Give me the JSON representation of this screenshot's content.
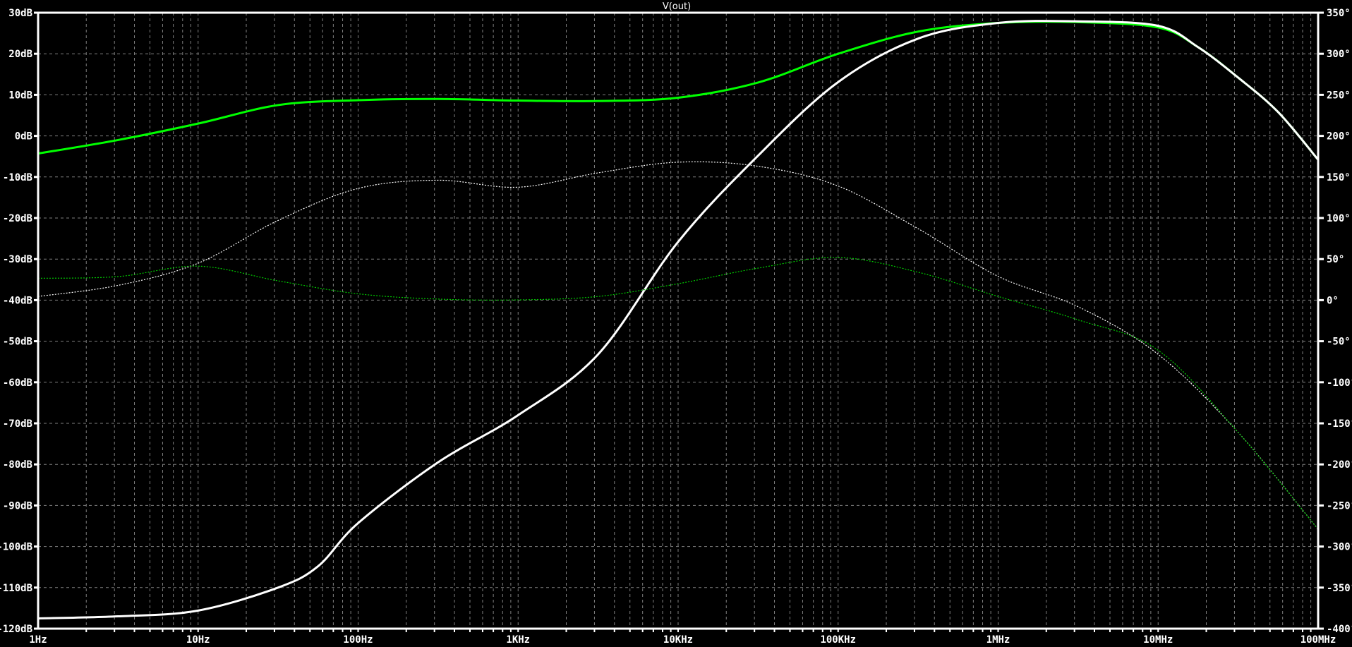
{
  "chart_data": {
    "type": "line",
    "title": "V(out)",
    "x_scale": "log",
    "xlim": [
      1,
      100000000
    ],
    "x_ticks": [
      1,
      10,
      100,
      1000,
      10000,
      100000,
      1000000,
      10000000,
      100000000
    ],
    "x_tick_labels": [
      "1Hz",
      "10Hz",
      "100Hz",
      "1KHz",
      "10KHz",
      "100KHz",
      "1MHz",
      "10MHz",
      "100MHz"
    ],
    "ylim_left": [
      -120,
      30
    ],
    "y_left_ticks": [
      30,
      20,
      10,
      0,
      -10,
      -20,
      -30,
      -40,
      -50,
      -60,
      -70,
      -80,
      -90,
      -100,
      -110,
      -120
    ],
    "y_left_tick_labels": [
      "30dB",
      "20dB",
      "10dB",
      "0dB",
      "-10dB",
      "-20dB",
      "-30dB",
      "-40dB",
      "-50dB",
      "-60dB",
      "-70dB",
      "-80dB",
      "-90dB",
      "-100dB",
      "-110dB",
      "-120dB"
    ],
    "ylim_right": [
      -400,
      350
    ],
    "y_right_tick_labels": [
      "350°",
      "300°",
      "250°",
      "200°",
      "150°",
      "100°",
      "50°",
      "0°",
      "-50°",
      "-100°",
      "-150°",
      "-200°",
      "-250°",
      "-300°",
      "-350°",
      "-400°"
    ],
    "grid": true,
    "background": "#000000",
    "grid_color": "#808080",
    "x": [
      1,
      3.16,
      10,
      31.6,
      100,
      316,
      1000,
      3162,
      10000,
      31623,
      100000,
      316228,
      1000000,
      3162278,
      10000000,
      17783,
      31622777,
      56234133,
      100000000
    ],
    "series": [
      {
        "axis": "left",
        "color": "#00ff00",
        "style": "solid",
        "x": [
          1,
          3.16,
          10,
          31.6,
          100,
          316,
          1000,
          3162,
          10000,
          31623,
          100000,
          316228,
          1000000,
          3162278,
          10000000,
          17782794,
          31622777,
          56234133,
          100000000
        ],
        "values": [
          -4.3,
          -1,
          3,
          7.5,
          8.7,
          9,
          8.6,
          8.5,
          9.3,
          13,
          20,
          25.4,
          27.5,
          27.7,
          26.4,
          21.6,
          14.2,
          5.8,
          -5.8
        ]
      },
      {
        "axis": "left",
        "color": "#ffffff",
        "style": "solid",
        "x": [
          1,
          3.16,
          10,
          31.6,
          56.2,
          100,
          316,
          1000,
          3162,
          10000,
          31623,
          100000,
          316228,
          1000000,
          3162278,
          10000000,
          17782794,
          31622777,
          56234133,
          100000000
        ],
        "values": [
          -117.5,
          -117,
          -115.6,
          -110,
          -104.8,
          -94.3,
          -79.5,
          -68,
          -53.2,
          -25.8,
          -4.8,
          13.1,
          23.7,
          27.5,
          27.9,
          26.8,
          21.6,
          14.2,
          5.8,
          -5.8
        ]
      },
      {
        "axis": "right",
        "color": "#ffffff",
        "style": "dotted",
        "x": [
          1,
          3.16,
          10,
          31.6,
          100,
          316,
          1000,
          3162,
          10000,
          31623,
          100000,
          316228,
          1000000,
          3162278,
          10000000,
          31622777,
          100000000
        ],
        "values": [
          4.5,
          18,
          45,
          97,
          136,
          146,
          137.5,
          155,
          168,
          163,
          139,
          87,
          29,
          -8,
          -66,
          -161,
          -279
        ]
      },
      {
        "axis": "right",
        "color": "#00cc00",
        "style": "dotted",
        "x": [
          1,
          3.16,
          10,
          31.6,
          100,
          316,
          1000,
          3162,
          10000,
          31623,
          100000,
          316228,
          1000000,
          3162278,
          10000000,
          31622777,
          100000000
        ],
        "values": [
          26.6,
          28.7,
          41.4,
          23.5,
          7.7,
          1.3,
          0.3,
          4.5,
          20,
          39,
          52,
          34,
          4.5,
          -24,
          -61,
          -161,
          -279
        ]
      }
    ]
  }
}
